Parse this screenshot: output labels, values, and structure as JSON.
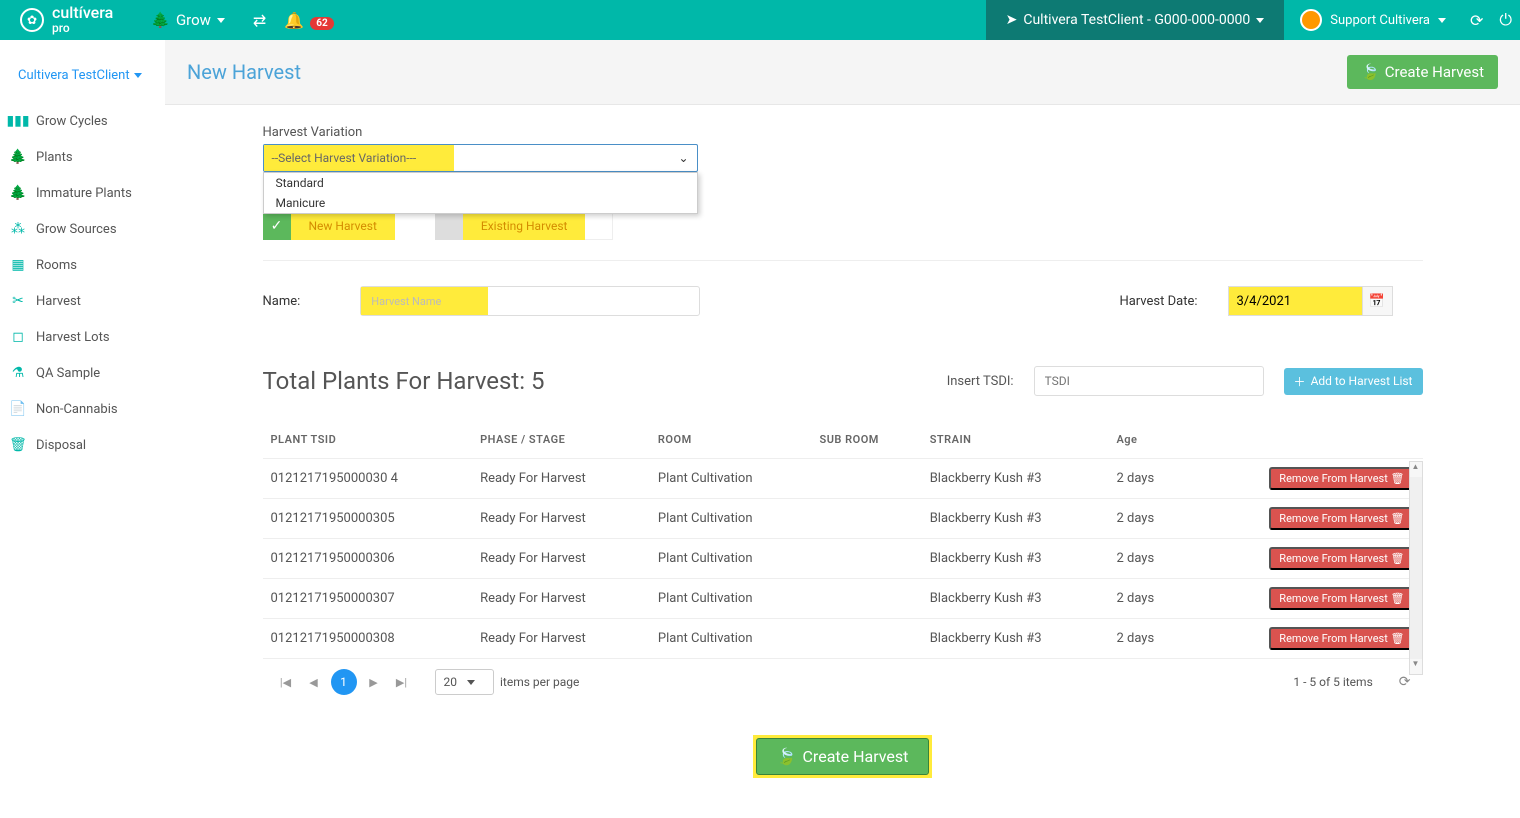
{
  "brand": {
    "name": "cultívera",
    "sub": "pro"
  },
  "top": {
    "grow": "Grow",
    "notif_count": "62",
    "client": "Cultivera TestClient - G000-000-0000",
    "user": "Support Cultivera"
  },
  "sidebar": {
    "client_selector": "Cultivera TestClient",
    "items": [
      {
        "icon": "bar-chart-icon",
        "label": "Grow Cycles"
      },
      {
        "icon": "tree-icon",
        "label": "Plants"
      },
      {
        "icon": "tree-icon",
        "label": "Immature Plants"
      },
      {
        "icon": "sources-icon",
        "label": "Grow Sources"
      },
      {
        "icon": "grid-icon",
        "label": "Rooms"
      },
      {
        "icon": "cut-icon",
        "label": "Harvest"
      },
      {
        "icon": "box-icon",
        "label": "Harvest Lots"
      },
      {
        "icon": "flask-icon",
        "label": "QA Sample"
      },
      {
        "icon": "doc-icon",
        "label": "Non-Cannabis"
      },
      {
        "icon": "trash-icon",
        "label": "Disposal"
      }
    ]
  },
  "page": {
    "title": "New Harvest",
    "create_btn": "Create Harvest"
  },
  "form": {
    "variation_label": "Harvest Variation",
    "variation_placeholder": "--Select Harvest Variation---",
    "variation_options": [
      "Standard",
      "Manicure"
    ],
    "new_harvest": "New Harvest",
    "existing_harvest": "Existing Harvest",
    "name_label": "Name:",
    "name_placeholder": "Harvest Name",
    "date_label": "Harvest Date:",
    "date_value": "3/4/2021"
  },
  "plants_section": {
    "title_prefix": "Total Plants For Harvest:  ",
    "count": "5",
    "tsdi_label": "Insert TSDI:",
    "tsdi_placeholder": "TSDI",
    "add_btn": "Add to Harvest List",
    "columns": [
      "PLANT TSID",
      "PHASE / STAGE",
      "ROOM",
      "SUB ROOM",
      "STRAIN",
      "Age",
      ""
    ],
    "rows": [
      {
        "tsid": "0121217195000030 4",
        "phase": "Ready For Harvest",
        "room": "Plant Cultivation",
        "sub": "",
        "strain": "Blackberry Kush #3",
        "age": "2 days"
      },
      {
        "tsid": "01212171950000305",
        "phase": "Ready For Harvest",
        "room": "Plant Cultivation",
        "sub": "",
        "strain": "Blackberry Kush #3",
        "age": "2 days"
      },
      {
        "tsid": "01212171950000306",
        "phase": "Ready For Harvest",
        "room": "Plant Cultivation",
        "sub": "",
        "strain": "Blackberry Kush #3",
        "age": "2 days"
      },
      {
        "tsid": "01212171950000307",
        "phase": "Ready For Harvest",
        "room": "Plant Cultivation",
        "sub": "",
        "strain": "Blackberry Kush #3",
        "age": "2 days"
      },
      {
        "tsid": "01212171950000308",
        "phase": "Ready For Harvest",
        "room": "Plant Cultivation",
        "sub": "",
        "strain": "Blackberry Kush #3",
        "age": "2 days"
      }
    ],
    "remove_btn": "Remove From Harvest"
  },
  "pager": {
    "page": "1",
    "page_size": "20",
    "per_page_text": "items per page",
    "summary": "1 - 5 of 5 items"
  },
  "bottom": {
    "create_btn": "Create Harvest"
  }
}
